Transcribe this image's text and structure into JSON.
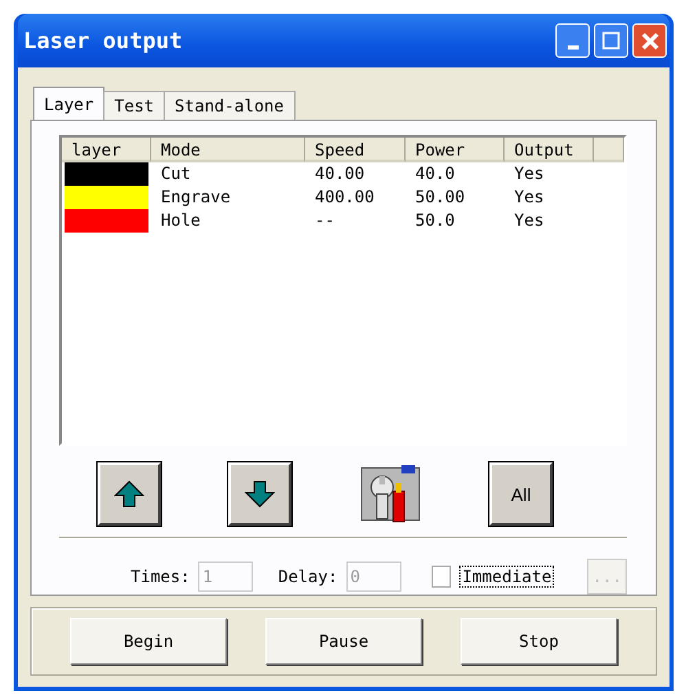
{
  "window": {
    "title": "Laser output"
  },
  "tabs": [
    {
      "label": "Layer",
      "selected": true
    },
    {
      "label": "Test",
      "selected": false
    },
    {
      "label": "Stand-alone",
      "selected": false
    }
  ],
  "table": {
    "columns": [
      "layer",
      "Mode",
      "Speed",
      "Power",
      "Output"
    ],
    "rows": [
      {
        "color": "#000000",
        "mode": "Cut",
        "speed": "40.00",
        "power": "40.0",
        "output": "Yes"
      },
      {
        "color": "#ffff00",
        "mode": "Engrave",
        "speed": "400.00",
        "power": "50.00",
        "output": "Yes"
      },
      {
        "color": "#ff0000",
        "mode": "Hole",
        "speed": "--",
        "power": "50.0",
        "output": "Yes"
      }
    ]
  },
  "tool_buttons": [
    {
      "kind": "up"
    },
    {
      "kind": "down"
    },
    {
      "kind": "tools"
    },
    {
      "kind": "text",
      "label": "All"
    }
  ],
  "times": {
    "label": "Times:",
    "value": "1",
    "disabled": true
  },
  "delay": {
    "label": "Delay:",
    "value": "0",
    "disabled": true
  },
  "immediate": {
    "label": "Immediate",
    "checked": false
  },
  "more_button": {
    "label": "...",
    "disabled": true
  },
  "actions": [
    "Begin",
    "Pause",
    "Stop"
  ]
}
